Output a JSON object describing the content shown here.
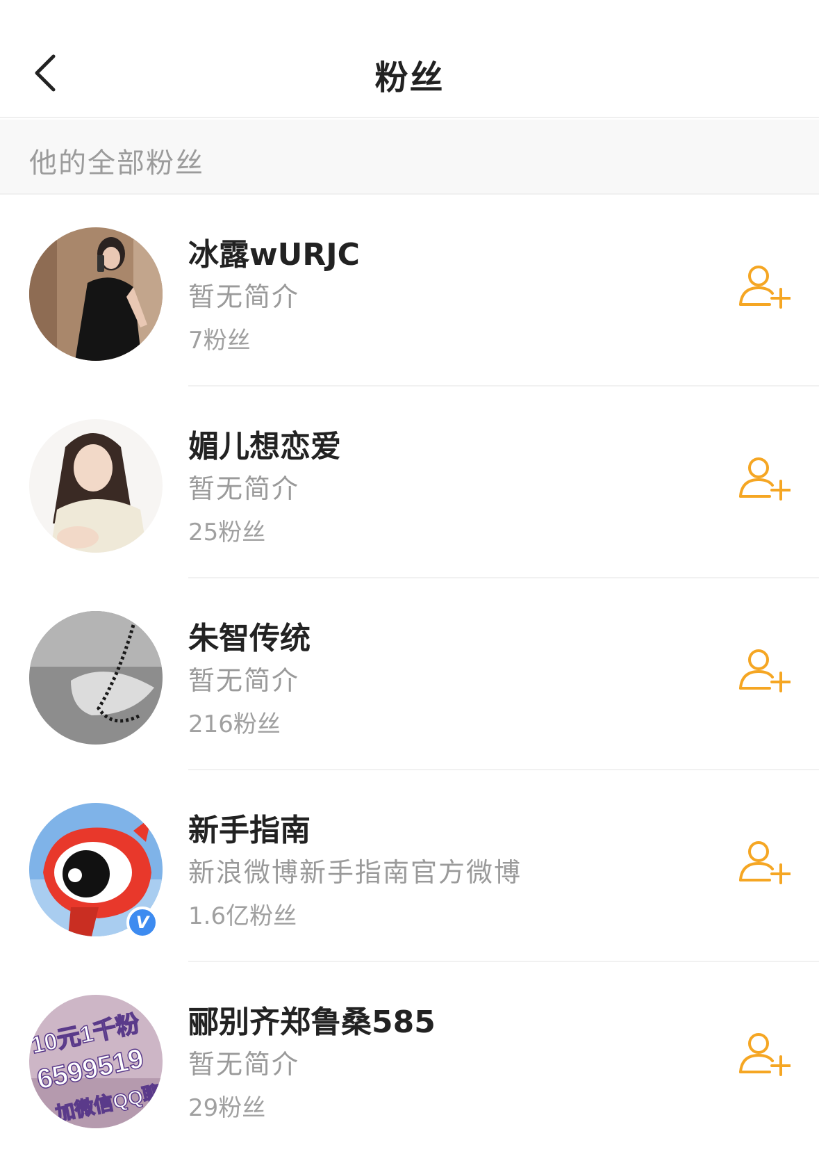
{
  "header": {
    "title": "粉丝",
    "back_icon": "chevron-left-icon"
  },
  "section": {
    "label": "他的全部粉丝"
  },
  "colors": {
    "accent": "#F5A623",
    "verified": "#3D8BF0"
  },
  "users": [
    {
      "name": "冰露wURJC",
      "bio": "暂无简介",
      "fans": "7粉丝",
      "verified": false,
      "avatar_icon": "avatar-photo"
    },
    {
      "name": "媚儿想恋爱",
      "bio": "暂无简介",
      "fans": "25粉丝",
      "verified": false,
      "avatar_icon": "avatar-photo"
    },
    {
      "name": "朱智传统",
      "bio": "暂无简介",
      "fans": "216粉丝",
      "verified": false,
      "avatar_icon": "avatar-photo"
    },
    {
      "name": "新手指南",
      "bio": "新浪微博新手指南官方微博",
      "fans": "1.6亿粉丝",
      "verified": true,
      "verified_mark": "V",
      "avatar_icon": "weibo-eye-logo"
    },
    {
      "name": "郦别齐郑鲁桑585",
      "bio": "暂无简介",
      "fans": "29粉丝",
      "verified": false,
      "avatar_icon": "avatar-photo",
      "avatar_text": [
        "10元1千粉",
        "6599519",
        "加微信QQ聊"
      ]
    }
  ]
}
